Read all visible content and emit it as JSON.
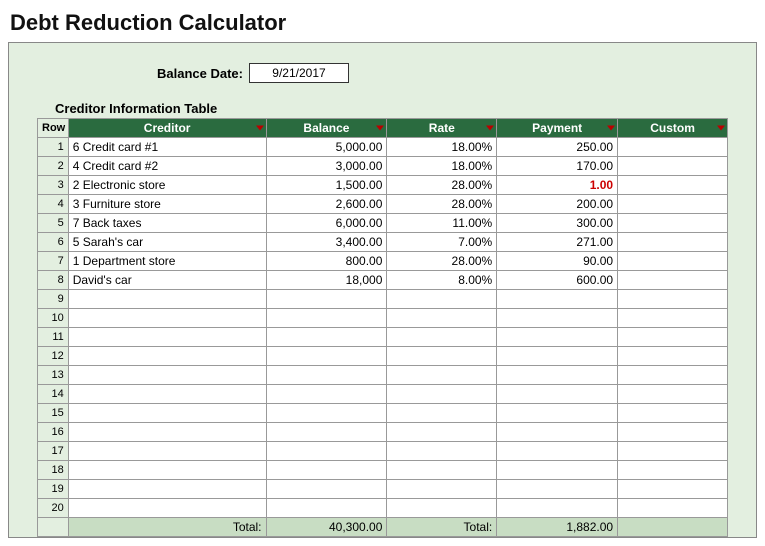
{
  "title": "Debt Reduction Calculator",
  "balance_date": {
    "label": "Balance Date:",
    "value": "9/21/2017"
  },
  "section_title": "Creditor Information Table",
  "row_head": "Row",
  "columns": {
    "creditor": "Creditor",
    "balance": "Balance",
    "rate": "Rate",
    "payment": "Payment",
    "custom": "Custom"
  },
  "rows": [
    {
      "n": "1",
      "creditor": "6 Credit card #1",
      "balance": "5,000.00",
      "rate": "18.00%",
      "payment": "250.00",
      "custom": ""
    },
    {
      "n": "2",
      "creditor": "4 Credit card #2",
      "balance": "3,000.00",
      "rate": "18.00%",
      "payment": "170.00",
      "custom": ""
    },
    {
      "n": "3",
      "creditor": "2 Electronic store",
      "balance": "1,500.00",
      "rate": "28.00%",
      "payment": "1.00",
      "payment_warn": true,
      "custom": ""
    },
    {
      "n": "4",
      "creditor": "3 Furniture store",
      "balance": "2,600.00",
      "rate": "28.00%",
      "payment": "200.00",
      "custom": ""
    },
    {
      "n": "5",
      "creditor": "7 Back taxes",
      "balance": "6,000.00",
      "rate": "11.00%",
      "payment": "300.00",
      "custom": ""
    },
    {
      "n": "6",
      "creditor": "5 Sarah's car",
      "balance": "3,400.00",
      "rate": "7.00%",
      "payment": "271.00",
      "custom": ""
    },
    {
      "n": "7",
      "creditor": "1 Department store",
      "balance": "800.00",
      "rate": "28.00%",
      "payment": "90.00",
      "custom": ""
    },
    {
      "n": "8",
      "creditor": "  David's car",
      "balance": "18,000",
      "rate": "8.00%",
      "payment": "600.00",
      "custom": ""
    },
    {
      "n": "9",
      "creditor": "",
      "balance": "",
      "rate": "",
      "payment": "",
      "custom": ""
    },
    {
      "n": "10",
      "creditor": "",
      "balance": "",
      "rate": "",
      "payment": "",
      "custom": ""
    },
    {
      "n": "11",
      "creditor": "",
      "balance": "",
      "rate": "",
      "payment": "",
      "custom": ""
    },
    {
      "n": "12",
      "creditor": "",
      "balance": "",
      "rate": "",
      "payment": "",
      "custom": ""
    },
    {
      "n": "13",
      "creditor": "",
      "balance": "",
      "rate": "",
      "payment": "",
      "custom": ""
    },
    {
      "n": "14",
      "creditor": "",
      "balance": "",
      "rate": "",
      "payment": "",
      "custom": ""
    },
    {
      "n": "15",
      "creditor": "",
      "balance": "",
      "rate": "",
      "payment": "",
      "custom": ""
    },
    {
      "n": "16",
      "creditor": "",
      "balance": "",
      "rate": "",
      "payment": "",
      "custom": ""
    },
    {
      "n": "17",
      "creditor": "",
      "balance": "",
      "rate": "",
      "payment": "",
      "custom": ""
    },
    {
      "n": "18",
      "creditor": "",
      "balance": "",
      "rate": "",
      "payment": "",
      "custom": ""
    },
    {
      "n": "19",
      "creditor": "",
      "balance": "",
      "rate": "",
      "payment": "",
      "custom": ""
    },
    {
      "n": "20",
      "creditor": "",
      "balance": "",
      "rate": "",
      "payment": "",
      "custom": ""
    }
  ],
  "totals": {
    "label": "Total:",
    "balance": "40,300.00",
    "payment_label": "Total:",
    "payment": "1,882.00"
  }
}
